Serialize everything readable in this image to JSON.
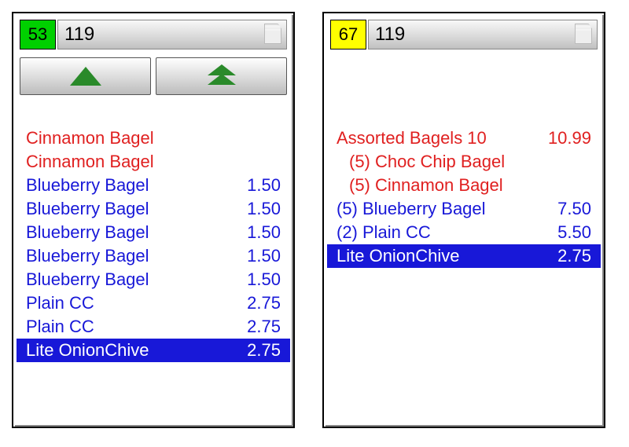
{
  "left": {
    "badge": "53",
    "number": "119",
    "items": [
      {
        "name": "Cinnamon Bagel",
        "price": "",
        "color": "red",
        "selected": false,
        "sub": false
      },
      {
        "name": "Cinnamon Bagel",
        "price": "",
        "color": "red",
        "selected": false,
        "sub": false
      },
      {
        "name": "Blueberry Bagel",
        "price": "1.50",
        "color": "blue",
        "selected": false,
        "sub": false
      },
      {
        "name": "Blueberry Bagel",
        "price": "1.50",
        "color": "blue",
        "selected": false,
        "sub": false
      },
      {
        "name": "Blueberry Bagel",
        "price": "1.50",
        "color": "blue",
        "selected": false,
        "sub": false
      },
      {
        "name": "Blueberry Bagel",
        "price": "1.50",
        "color": "blue",
        "selected": false,
        "sub": false
      },
      {
        "name": "Blueberry Bagel",
        "price": "1.50",
        "color": "blue",
        "selected": false,
        "sub": false
      },
      {
        "name": "Plain CC",
        "price": "2.75",
        "color": "blue",
        "selected": false,
        "sub": false
      },
      {
        "name": "Plain CC",
        "price": "2.75",
        "color": "blue",
        "selected": false,
        "sub": false
      },
      {
        "name": "Lite OnionChive",
        "price": "2.75",
        "color": "blue",
        "selected": true,
        "sub": false
      }
    ]
  },
  "right": {
    "badge": "67",
    "number": "119",
    "items": [
      {
        "name": "Assorted Bagels 10",
        "price": "10.99",
        "color": "red",
        "selected": false,
        "sub": false
      },
      {
        "name": "(5)  Choc Chip Bagel",
        "price": "",
        "color": "red",
        "selected": false,
        "sub": true
      },
      {
        "name": "(5)  Cinnamon Bagel",
        "price": "",
        "color": "red",
        "selected": false,
        "sub": true
      },
      {
        "name": "(5) Blueberry Bagel",
        "price": "7.50",
        "color": "blue",
        "selected": false,
        "sub": false
      },
      {
        "name": "(2) Plain CC",
        "price": "5.50",
        "color": "blue",
        "selected": false,
        "sub": false
      },
      {
        "name": "Lite OnionChive",
        "price": "2.75",
        "color": "blue",
        "selected": true,
        "sub": false
      }
    ]
  }
}
